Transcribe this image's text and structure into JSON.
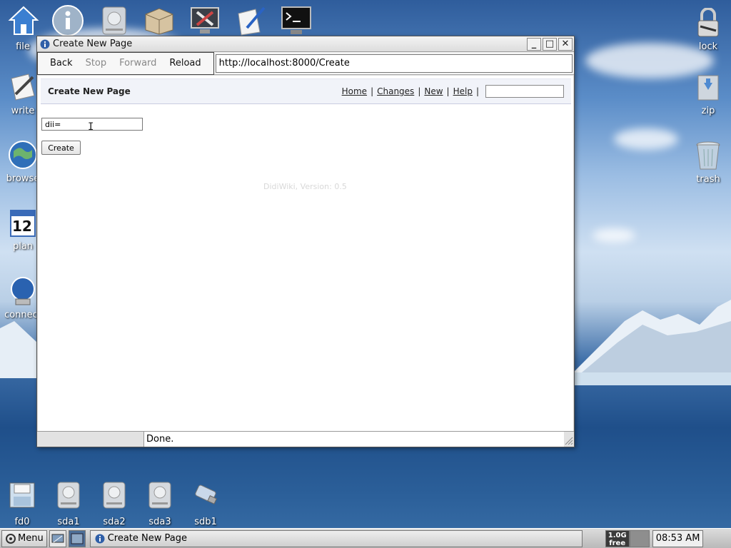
{
  "desktop": {
    "left_icons": [
      {
        "label": "file"
      },
      {
        "label": "write"
      },
      {
        "label": "browse"
      },
      {
        "label": "plan",
        "day": "12"
      },
      {
        "label": "connect"
      }
    ],
    "right_icons": [
      {
        "label": "lock"
      },
      {
        "label": "zip"
      },
      {
        "label": "trash"
      }
    ],
    "drives": [
      {
        "label": "fd0"
      },
      {
        "label": "sda1"
      },
      {
        "label": "sda2"
      },
      {
        "label": "sda3"
      },
      {
        "label": "sdb1"
      }
    ]
  },
  "window": {
    "title": "Create New Page",
    "minimize": "_",
    "maximize": "□",
    "close": "✕"
  },
  "browser": {
    "back": "Back",
    "stop": "Stop",
    "forward": "Forward",
    "reload": "Reload",
    "url": "http://localhost:8000/Create",
    "status": "Done."
  },
  "wiki": {
    "page_title": "Create New Page",
    "links": [
      "Home",
      "Changes",
      "New",
      "Help"
    ],
    "separator": "|",
    "page_name_value": "dii=",
    "create_label": "Create",
    "version": "DidiWiki, Version: 0.5"
  },
  "taskbar": {
    "menu_label": "Menu",
    "task_title": "Create New Page",
    "free_amount": "1.0G",
    "free_label": "free",
    "clock": "08:53 AM"
  }
}
